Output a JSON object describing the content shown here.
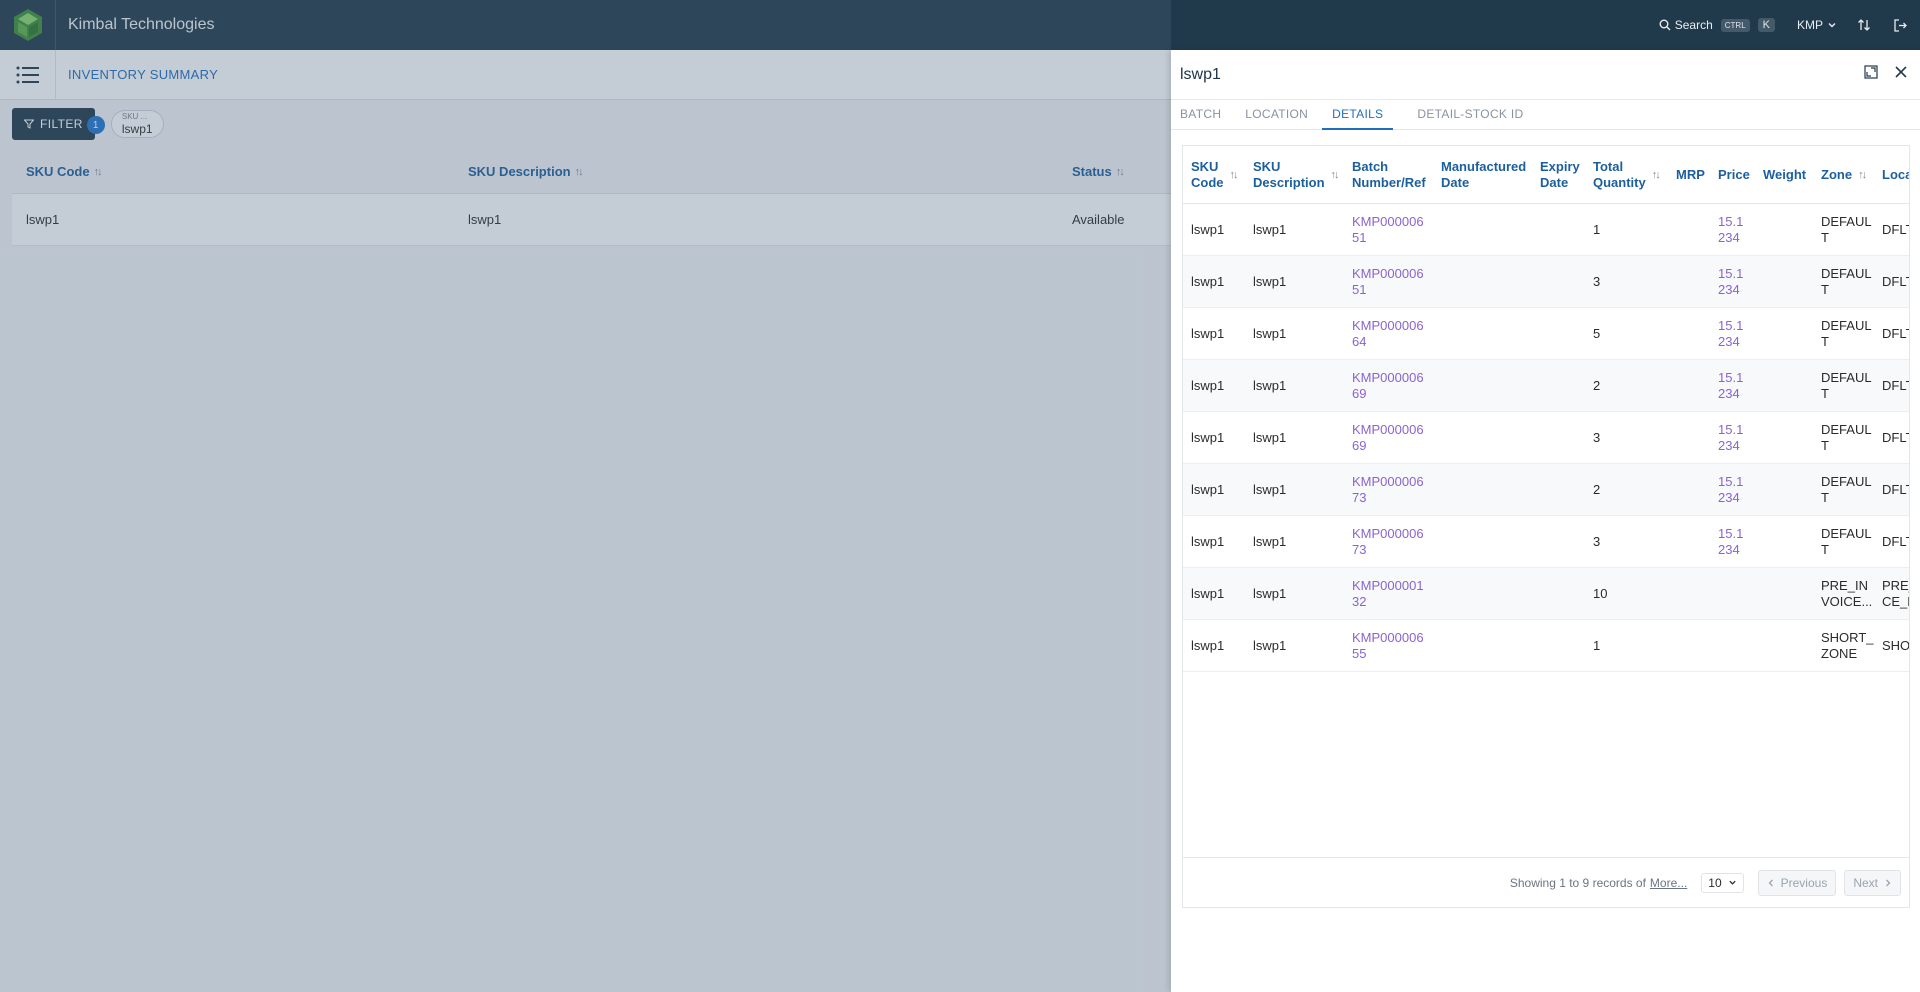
{
  "app": {
    "title": "Kimbal Technologies"
  },
  "topbar": {
    "search_label": "Search",
    "kbd_ctrl": "CTRL",
    "kbd_k": "K",
    "user": "KMP"
  },
  "page": {
    "title": "INVENTORY SUMMARY"
  },
  "filter": {
    "label": "FILTER",
    "count": "1",
    "chip_label": "SKU ...",
    "chip_value": "lswp1"
  },
  "main_table": {
    "headers": [
      "SKU Code",
      "SKU Description",
      "Status"
    ],
    "rows": [
      [
        "lswp1",
        "lswp1",
        "Available"
      ]
    ]
  },
  "panel": {
    "title": "lswp1",
    "tabs": [
      "BATCH",
      "LOCATION",
      "DETAILS",
      "DETAIL-STOCK ID"
    ],
    "active_tab": "DETAILS",
    "headers": [
      "SKU\nCode",
      "SKU\nDescription",
      "Batch\nNumber/Ref",
      "Manufactured\nDate",
      "Expiry\nDate",
      "Total\nQuantity",
      "MRP",
      "Price",
      "Weight",
      "Zone",
      "Loca"
    ],
    "rows": [
      [
        "lswp1",
        "lswp1",
        "KMP000006\n51",
        "",
        "",
        "1",
        "",
        "15.1\n234",
        "",
        "DEFAUL\nT",
        "DFLT"
      ],
      [
        "lswp1",
        "lswp1",
        "KMP000006\n51",
        "",
        "",
        "3",
        "",
        "15.1\n234",
        "",
        "DEFAUL\nT",
        "DFLT"
      ],
      [
        "lswp1",
        "lswp1",
        "KMP000006\n64",
        "",
        "",
        "5",
        "",
        "15.1\n234",
        "",
        "DEFAUL\nT",
        "DFLT"
      ],
      [
        "lswp1",
        "lswp1",
        "KMP000006\n69",
        "",
        "",
        "2",
        "",
        "15.1\n234",
        "",
        "DEFAUL\nT",
        "DFLT"
      ],
      [
        "lswp1",
        "lswp1",
        "KMP000006\n69",
        "",
        "",
        "3",
        "",
        "15.1\n234",
        "",
        "DEFAUL\nT",
        "DFLT"
      ],
      [
        "lswp1",
        "lswp1",
        "KMP000006\n73",
        "",
        "",
        "2",
        "",
        "15.1\n234",
        "",
        "DEFAUL\nT",
        "DFLT"
      ],
      [
        "lswp1",
        "lswp1",
        "KMP000006\n73",
        "",
        "",
        "3",
        "",
        "15.1\n234",
        "",
        "DEFAUL\nT",
        "DFLT"
      ],
      [
        "lswp1",
        "lswp1",
        "KMP000001\n32",
        "",
        "",
        "10",
        "",
        "",
        "",
        "PRE_IN\nVOICE...",
        "PRE_\nCE_D"
      ],
      [
        "lswp1",
        "lswp1",
        "KMP000006\n55",
        "",
        "",
        "1",
        "",
        "",
        "",
        "SHORT_\nZONE",
        "SHO"
      ]
    ],
    "pager": {
      "summary": "Showing 1 to 9 records of",
      "more": "More...",
      "page_size": "10",
      "prev": "Previous",
      "next": "Next"
    }
  },
  "colors": {
    "topbar": "#213a4b",
    "accent": "#1f6fbf",
    "link": "#8a63d2",
    "logo_green": "#6cc04a"
  }
}
